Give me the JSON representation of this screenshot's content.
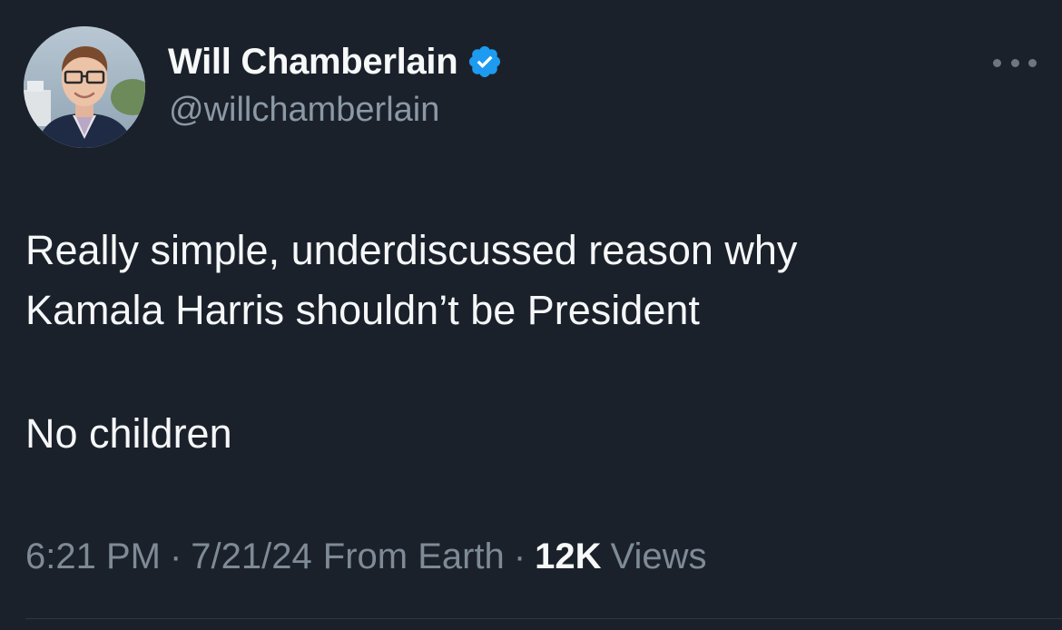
{
  "author": {
    "display_name": "Will Chamberlain",
    "handle": "@willchamberlain",
    "verified": true
  },
  "tweet": {
    "line1": "Really simple, underdiscussed reason why",
    "line2": "Kamala Harris shouldn’t be President",
    "line3": "No children"
  },
  "meta": {
    "time": "6:21 PM",
    "date": "7/21/24",
    "source": "From Earth",
    "separator": "·",
    "views_count": "12K",
    "views_label": "Views"
  },
  "icons": {
    "verified": "verified-badge-icon",
    "more": "more-options-icon"
  },
  "colors": {
    "background": "#1b212b",
    "verified_blue": "#1d9bf0",
    "secondary_text": "#8b98a5"
  }
}
